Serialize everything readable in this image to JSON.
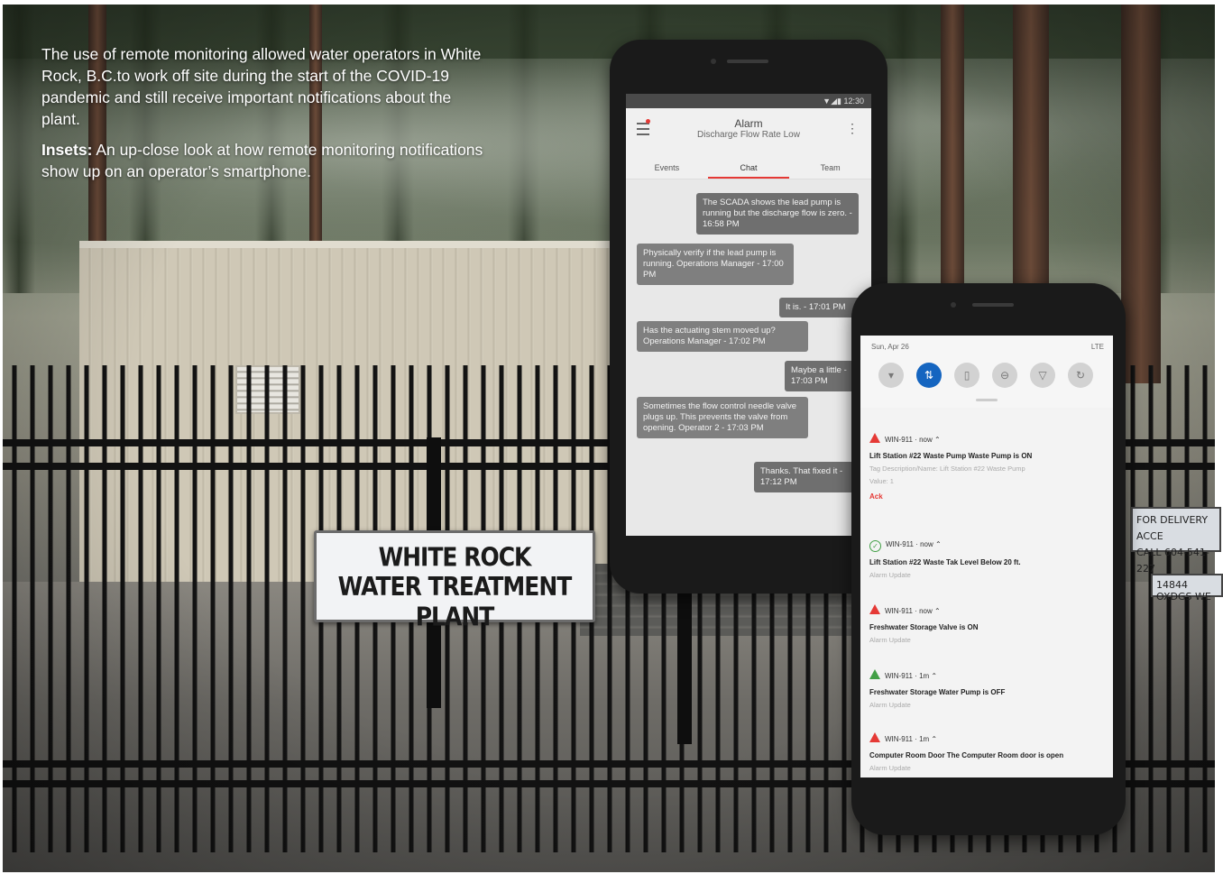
{
  "caption": {
    "paragraph1": "The use of remote monitoring allowed water operators in White Rock, B.C.to work off site during the start of the COVID-19 pandemic and still receive important notifications about the plant.",
    "insets_label": "Insets:",
    "insets_text": "An up-close look at how remote monitoring notifications show up on an operator’s smartphone."
  },
  "sign": {
    "line1": "WHITE ROCK",
    "line2": "WATER TREATMENT PLANT"
  },
  "side_sign": {
    "line1": "FOR DELIVERY ACCE",
    "line2": "CALL 604-541-227",
    "plate": "14844 OXDGS WE"
  },
  "phone1": {
    "status_time": "12:30",
    "title": "Alarm",
    "subtitle": "Discharge Flow Rate Low",
    "tabs": [
      "Events",
      "Chat",
      "Team"
    ],
    "messages": [
      {
        "text": "The SCADA shows the lead pump is running but the discharge flow is zero. - 16:58 PM",
        "side": "right"
      },
      {
        "text": "Physically verify if the lead pump is running. Operations Manager - 17:00 PM",
        "side": "left"
      },
      {
        "text": "It is. - 17:01 PM",
        "side": "right"
      },
      {
        "text": "Has the actuating stem moved up? Operations Manager - 17:02 PM",
        "side": "left"
      },
      {
        "text": "Maybe a little - 17:03 PM",
        "side": "right"
      },
      {
        "text": "Sometimes the flow control needle valve plugs up. This prevents the valve from opening. Operator 2 - 17:03 PM",
        "side": "left"
      },
      {
        "text": "Thanks. That fixed it - 17:12 PM",
        "side": "right"
      }
    ]
  },
  "phone2": {
    "date": "Sun, Apr 26",
    "signal": "LTE",
    "notifications": [
      {
        "source": "WIN-911 · now ⌃",
        "title": "Lift Station #22 Waste Pump Waste Pump is ON",
        "sub": "Tag Description/Name: Lift Station #22 Waste Pump",
        "extra": "Value: 1",
        "action": "Ack",
        "icon": "red-triangle"
      },
      {
        "source": "WIN-911 · now ⌃",
        "title": "Lift Station #22 Waste Tak Level Below 20 ft.",
        "sub": "Alarm Update",
        "icon": "green-check"
      },
      {
        "source": "WIN-911 · now ⌃",
        "title": "Freshwater Storage Valve is ON",
        "sub": "Alarm Update",
        "icon": "red-triangle"
      },
      {
        "source": "WIN-911 · 1m ⌃",
        "title": "Freshwater Storage Water Pump is OFF",
        "sub": "Alarm Update",
        "icon": "green-triangle"
      },
      {
        "source": "WIN-911 · 1m ⌃",
        "title": "Computer Room Door The Computer Room door is open",
        "sub": "Alarm Update",
        "icon": "red-triangle"
      }
    ]
  }
}
